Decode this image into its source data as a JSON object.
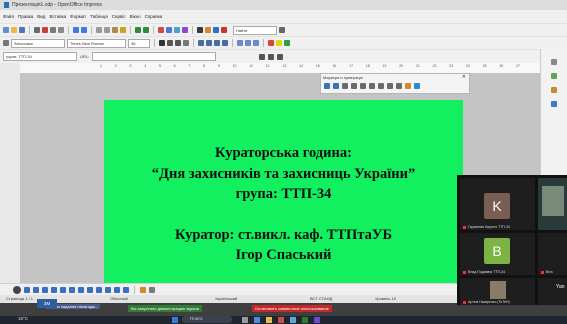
{
  "window": {
    "title": "Презентація1.odp - OpenOffice Impress"
  },
  "menu": [
    "Файл",
    "Правка",
    "Вид",
    "Вставка",
    "Формат",
    "Таблиця",
    "Сервіс",
    "Вікно",
    "Справка"
  ],
  "toolbar": {
    "search_placeholder": "Найти",
    "style_value": "Заголовок",
    "font_value": "Times New Roman",
    "size_value": "36",
    "url_label": "URL:",
    "group_value": "група: ТТП-34"
  },
  "ruler": {
    "ticks": [
      "1",
      "2",
      "3",
      "4",
      "5",
      "6",
      "7",
      "8",
      "9",
      "10",
      "11",
      "12",
      "13",
      "14",
      "15",
      "16",
      "17",
      "18",
      "19",
      "20",
      "21",
      "22",
      "23",
      "24",
      "25",
      "26",
      "27"
    ]
  },
  "navigator": {
    "title": "Маркери и нумерація"
  },
  "slide": {
    "line1": "Кураторська година:",
    "line2": "“Дня захисників та захисниць України”",
    "line3": "група: ТТП-34",
    "line4": "Куратор: ст.викл. каф. ТТПтаУБ",
    "line5": "Ігор Спаський",
    "background": "#12f060"
  },
  "status": {
    "slide": "Страница 1 / 1",
    "layout": "Обычный",
    "language": "Український",
    "mode": "ВСТ СТАНД",
    "zoom": "Уровень 10"
  },
  "notifications": {
    "n1": "Зачем надання налагодж...",
    "n2": "Вы запустили демонстрацию экрана",
    "n3": "Остановить совместное использование"
  },
  "taskbar": {
    "search": "Поиск",
    "temp": "16°C",
    "corner_label": "ЗМ"
  },
  "video": {
    "participants": [
      {
        "initial": "K",
        "name": "Гарасеміч Кирило ТТП-34",
        "color": "#7a5d53"
      },
      {
        "initial": "B",
        "name": "Влад Подавіна ТТП-34",
        "color": "#7cb342"
      },
      {
        "initial": "",
        "name": "Артем Назаренко (TeTeH)",
        "color": "#4b4b4b"
      }
    ],
    "right_names": [
      "Віта",
      "Yan"
    ]
  }
}
